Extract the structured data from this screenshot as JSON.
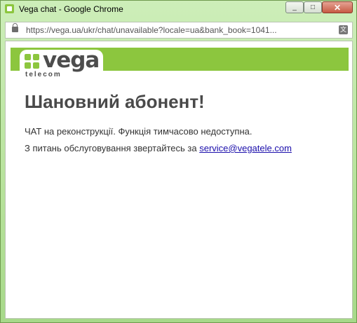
{
  "window": {
    "title": "Vega chat - Google Chrome"
  },
  "address_bar": {
    "url": "https://vega.ua/ukr/chat/unavailable?locale=ua&bank_book=1041..."
  },
  "logo": {
    "brand": "vega",
    "sub": "telecom"
  },
  "page": {
    "heading": "Шановний абонент!",
    "line1": "ЧАТ на реконструкції. Функція тимчасово недоступна.",
    "line2_prefix": "З питань обслуговування звертайтесь за ",
    "email": "service@vegatele.com"
  },
  "colors": {
    "brand_green": "#8cc63e",
    "frame_green": "#b6e29a"
  }
}
